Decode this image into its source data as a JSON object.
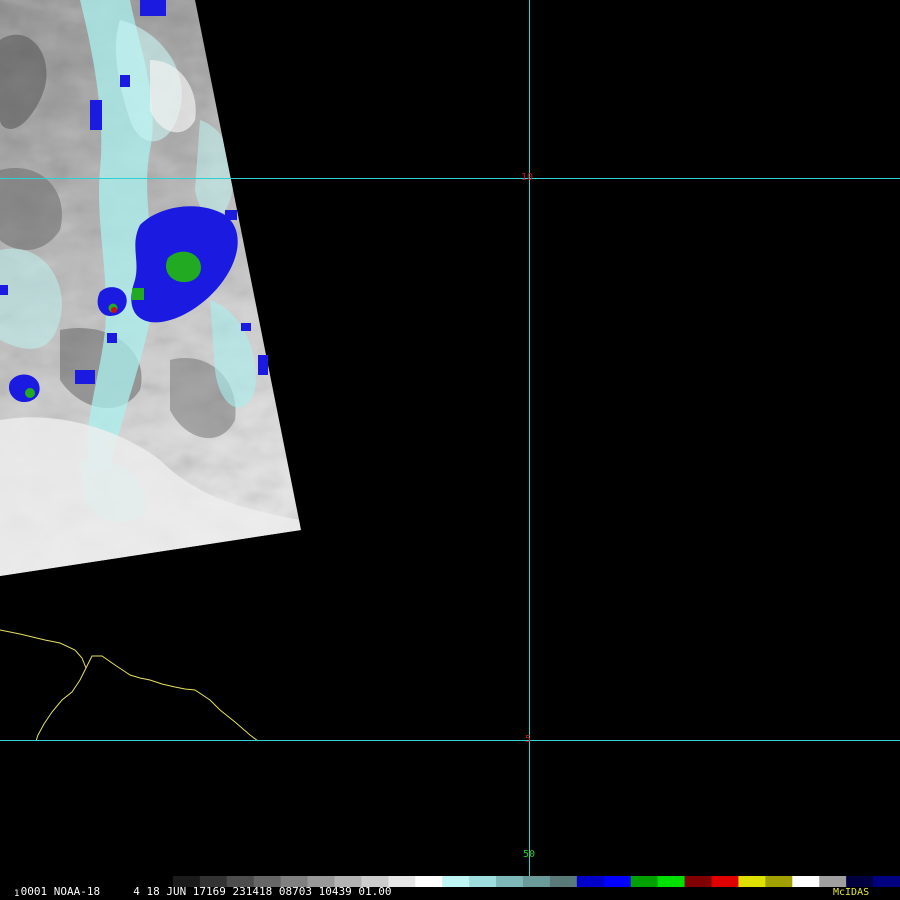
{
  "grid": {
    "lat_10": "10",
    "lat_5": "5",
    "lon_50": "50"
  },
  "footer": {
    "frame_digit": "1",
    "info_text": " 0001 NOAA-18     4 18 JUN 17169 231418 08703 10439 01.00",
    "brand": "McIDAS"
  },
  "colors": {
    "grid_line": "#2fd0d0",
    "grid_label_lat": "#c01818",
    "grid_label_lon": "#22cc22",
    "coastline": "#e6e060",
    "footer_text": "#ffffff",
    "brand_text": "#e6e640",
    "cloud_cold_cyan": "#a9f0ef",
    "convective_blue": "#1a1ae0",
    "convective_green": "#22aa22",
    "convective_red": "#cc1010"
  },
  "colorbar_stops": [
    "#000000",
    "#1a1a1a",
    "#333333",
    "#4d4d4d",
    "#666666",
    "#808080",
    "#999999",
    "#b3b3b3",
    "#cccccc",
    "#e6e6e6",
    "#ffffff",
    "#bff5f5",
    "#9fdede",
    "#7fb8b8",
    "#6a9a9a",
    "#5a7a7a",
    "#0000c8",
    "#0000ff",
    "#00a000",
    "#00e000",
    "#800000",
    "#e00000",
    "#e0e000",
    "#a0a000",
    "#ffffff",
    "#a0a0a0",
    "#000040",
    "#000080"
  ]
}
